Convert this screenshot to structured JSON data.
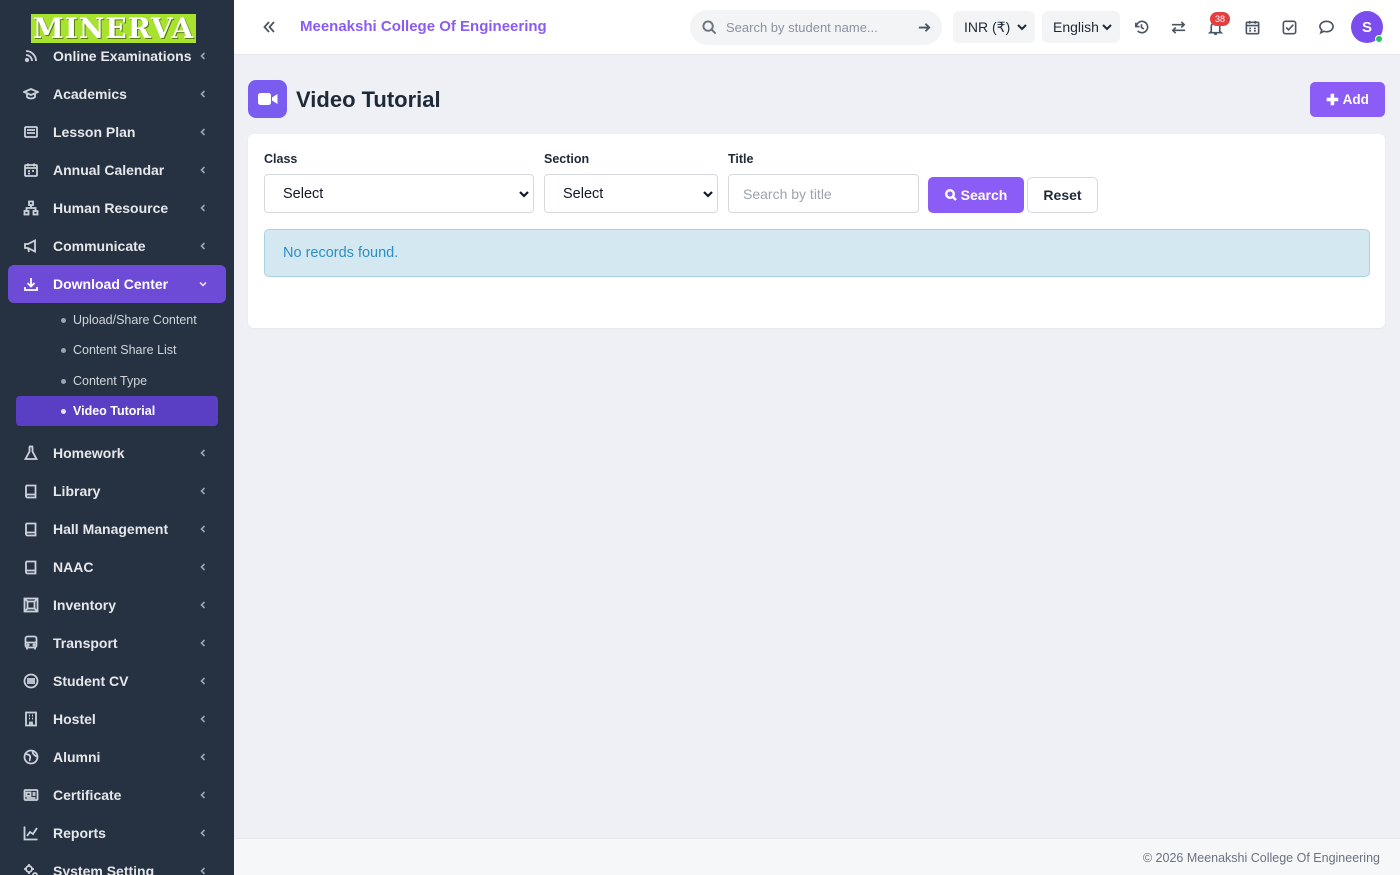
{
  "sidebar": {
    "logo_text": "MINERVA",
    "items": [
      {
        "label": "Online Examinations",
        "icon": "rss-icon"
      },
      {
        "label": "Academics",
        "icon": "graduation-cap-icon"
      },
      {
        "label": "Lesson Plan",
        "icon": "list-icon"
      },
      {
        "label": "Annual Calendar",
        "icon": "calendar-icon"
      },
      {
        "label": "Human Resource",
        "icon": "sitemap-icon"
      },
      {
        "label": "Communicate",
        "icon": "bullhorn-icon"
      },
      {
        "label": "Download Center",
        "icon": "download-icon"
      },
      {
        "label": "Homework",
        "icon": "flask-icon"
      },
      {
        "label": "Library",
        "icon": "book-icon"
      },
      {
        "label": "Hall Management",
        "icon": "book-icon"
      },
      {
        "label": "NAAC",
        "icon": "book-icon"
      },
      {
        "label": "Inventory",
        "icon": "inventory-icon"
      },
      {
        "label": "Transport",
        "icon": "bus-icon"
      },
      {
        "label": "Student CV",
        "icon": "cv-icon"
      },
      {
        "label": "Hostel",
        "icon": "building-icon"
      },
      {
        "label": "Alumni",
        "icon": "globe-icon"
      },
      {
        "label": "Certificate",
        "icon": "certificate-icon"
      },
      {
        "label": "Reports",
        "icon": "chart-line-icon"
      },
      {
        "label": "System Setting",
        "icon": "gears-icon"
      }
    ],
    "sub_items": [
      {
        "label": "Upload/Share Content"
      },
      {
        "label": "Content Share List"
      },
      {
        "label": "Content Type"
      },
      {
        "label": "Video Tutorial"
      }
    ]
  },
  "header": {
    "college_name": "Meenakshi College Of Engineering",
    "search_placeholder": "Search by student name...",
    "currency": "INR (₹)",
    "language": "English",
    "notification_count": "38",
    "avatar_initial": "S"
  },
  "main": {
    "title": "Video Tutorial",
    "add_label": "Add",
    "filters": {
      "class_label": "Class",
      "class_value": "Select",
      "section_label": "Section",
      "section_value": "Select",
      "title_label": "Title",
      "title_placeholder": "Search by title",
      "search_label": "Search",
      "reset_label": "Reset"
    },
    "empty_message": "No records found."
  },
  "footer": {
    "text": "© 2026 Meenakshi College Of Engineering"
  },
  "colors": {
    "sidebar_bg": "#263241",
    "accent": "#8b5cf6",
    "active_item": "#6d4bd6",
    "alert_bg": "#d3e8f1",
    "alert_text": "#2f8fc0"
  }
}
